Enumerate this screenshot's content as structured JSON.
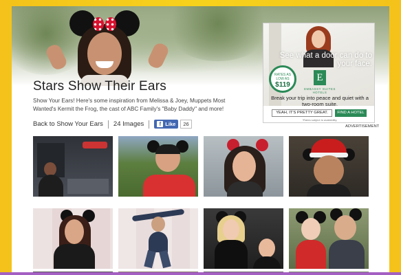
{
  "page": {
    "title": "Stars Show Their Ears",
    "description": "Show Your Ears! Here's some inspiration from Melissa & Joey, Muppets Most Wanted's Kermit the Frog, the cast of ABC Family's \"Baby Daddy\" and more!",
    "back_link": "Back to Show Your Ears",
    "image_count": "24 Images",
    "fb_like_label": "Like",
    "fb_like_count": "26"
  },
  "ad": {
    "headline": "See what a door can do to your face.",
    "rate_line1": "RATES AS",
    "rate_line2": "LOW AS",
    "rate_price": "$119",
    "logo_letter": "E",
    "brand": "EMBASSY SUITES HOTELS",
    "copy": "Break your trip into peace and quiet with a two-room suite.",
    "cta_primary": "YEAH, IT'S PRETTY GREAT.",
    "cta_secondary": "FIND A HOTEL",
    "fine_print": "*Rates subject to availability.",
    "label": "ADVERTISEMENT"
  },
  "thumbnails": [
    {
      "name": "radio-studio-host",
      "bg": "#3b3e45",
      "accent": "#6b4a3a"
    },
    {
      "name": "man-red-shirt-ears",
      "bg": "#5c7e3e",
      "accent": "#d93131"
    },
    {
      "name": "woman-red-bow-ears",
      "bg": "#9aa3a8",
      "accent": "#c81f2f"
    },
    {
      "name": "man-santa-ears",
      "bg": "#3a3530",
      "accent": "#c91d1d"
    },
    {
      "name": "woman-radio-disney-backdrop",
      "bg": "#e9dcdc",
      "accent": "#1a1a1a"
    },
    {
      "name": "man-jumping-radio-disney",
      "bg": "#ece3e3",
      "accent": "#2d3a55"
    },
    {
      "name": "two-women-love-shirt",
      "bg": "#2a2a2a",
      "accent": "#f4f4f4"
    },
    {
      "name": "couple-with-ears",
      "bg": "#6a7b53",
      "accent": "#d12a2a"
    }
  ],
  "colors": {
    "frame": "#f4c21a",
    "fb_blue": "#4267b2",
    "hotel_green": "#2b8a57"
  }
}
